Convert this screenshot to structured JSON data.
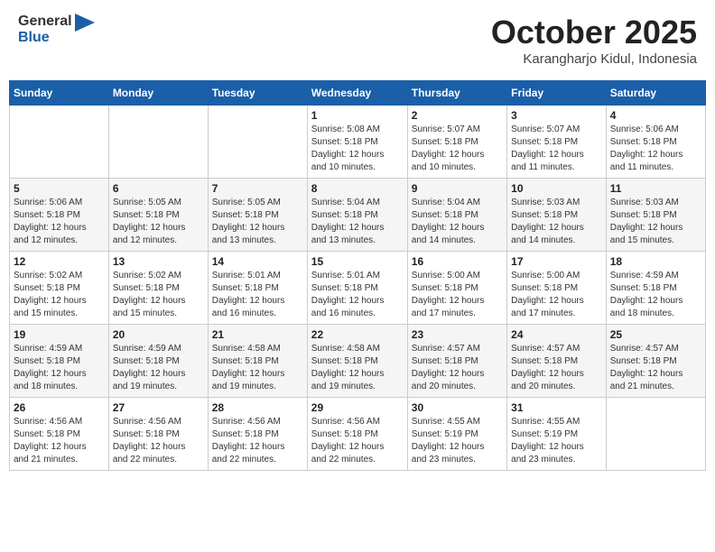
{
  "header": {
    "logo_line1": "General",
    "logo_line2": "Blue",
    "month": "October 2025",
    "location": "Karangharjo Kidul, Indonesia"
  },
  "calendar": {
    "days_of_week": [
      "Sunday",
      "Monday",
      "Tuesday",
      "Wednesday",
      "Thursday",
      "Friday",
      "Saturday"
    ],
    "weeks": [
      [
        {
          "day": "",
          "info": ""
        },
        {
          "day": "",
          "info": ""
        },
        {
          "day": "",
          "info": ""
        },
        {
          "day": "1",
          "info": "Sunrise: 5:08 AM\nSunset: 5:18 PM\nDaylight: 12 hours\nand 10 minutes."
        },
        {
          "day": "2",
          "info": "Sunrise: 5:07 AM\nSunset: 5:18 PM\nDaylight: 12 hours\nand 10 minutes."
        },
        {
          "day": "3",
          "info": "Sunrise: 5:07 AM\nSunset: 5:18 PM\nDaylight: 12 hours\nand 11 minutes."
        },
        {
          "day": "4",
          "info": "Sunrise: 5:06 AM\nSunset: 5:18 PM\nDaylight: 12 hours\nand 11 minutes."
        }
      ],
      [
        {
          "day": "5",
          "info": "Sunrise: 5:06 AM\nSunset: 5:18 PM\nDaylight: 12 hours\nand 12 minutes."
        },
        {
          "day": "6",
          "info": "Sunrise: 5:05 AM\nSunset: 5:18 PM\nDaylight: 12 hours\nand 12 minutes."
        },
        {
          "day": "7",
          "info": "Sunrise: 5:05 AM\nSunset: 5:18 PM\nDaylight: 12 hours\nand 13 minutes."
        },
        {
          "day": "8",
          "info": "Sunrise: 5:04 AM\nSunset: 5:18 PM\nDaylight: 12 hours\nand 13 minutes."
        },
        {
          "day": "9",
          "info": "Sunrise: 5:04 AM\nSunset: 5:18 PM\nDaylight: 12 hours\nand 14 minutes."
        },
        {
          "day": "10",
          "info": "Sunrise: 5:03 AM\nSunset: 5:18 PM\nDaylight: 12 hours\nand 14 minutes."
        },
        {
          "day": "11",
          "info": "Sunrise: 5:03 AM\nSunset: 5:18 PM\nDaylight: 12 hours\nand 15 minutes."
        }
      ],
      [
        {
          "day": "12",
          "info": "Sunrise: 5:02 AM\nSunset: 5:18 PM\nDaylight: 12 hours\nand 15 minutes."
        },
        {
          "day": "13",
          "info": "Sunrise: 5:02 AM\nSunset: 5:18 PM\nDaylight: 12 hours\nand 15 minutes."
        },
        {
          "day": "14",
          "info": "Sunrise: 5:01 AM\nSunset: 5:18 PM\nDaylight: 12 hours\nand 16 minutes."
        },
        {
          "day": "15",
          "info": "Sunrise: 5:01 AM\nSunset: 5:18 PM\nDaylight: 12 hours\nand 16 minutes."
        },
        {
          "day": "16",
          "info": "Sunrise: 5:00 AM\nSunset: 5:18 PM\nDaylight: 12 hours\nand 17 minutes."
        },
        {
          "day": "17",
          "info": "Sunrise: 5:00 AM\nSunset: 5:18 PM\nDaylight: 12 hours\nand 17 minutes."
        },
        {
          "day": "18",
          "info": "Sunrise: 4:59 AM\nSunset: 5:18 PM\nDaylight: 12 hours\nand 18 minutes."
        }
      ],
      [
        {
          "day": "19",
          "info": "Sunrise: 4:59 AM\nSunset: 5:18 PM\nDaylight: 12 hours\nand 18 minutes."
        },
        {
          "day": "20",
          "info": "Sunrise: 4:59 AM\nSunset: 5:18 PM\nDaylight: 12 hours\nand 19 minutes."
        },
        {
          "day": "21",
          "info": "Sunrise: 4:58 AM\nSunset: 5:18 PM\nDaylight: 12 hours\nand 19 minutes."
        },
        {
          "day": "22",
          "info": "Sunrise: 4:58 AM\nSunset: 5:18 PM\nDaylight: 12 hours\nand 19 minutes."
        },
        {
          "day": "23",
          "info": "Sunrise: 4:57 AM\nSunset: 5:18 PM\nDaylight: 12 hours\nand 20 minutes."
        },
        {
          "day": "24",
          "info": "Sunrise: 4:57 AM\nSunset: 5:18 PM\nDaylight: 12 hours\nand 20 minutes."
        },
        {
          "day": "25",
          "info": "Sunrise: 4:57 AM\nSunset: 5:18 PM\nDaylight: 12 hours\nand 21 minutes."
        }
      ],
      [
        {
          "day": "26",
          "info": "Sunrise: 4:56 AM\nSunset: 5:18 PM\nDaylight: 12 hours\nand 21 minutes."
        },
        {
          "day": "27",
          "info": "Sunrise: 4:56 AM\nSunset: 5:18 PM\nDaylight: 12 hours\nand 22 minutes."
        },
        {
          "day": "28",
          "info": "Sunrise: 4:56 AM\nSunset: 5:18 PM\nDaylight: 12 hours\nand 22 minutes."
        },
        {
          "day": "29",
          "info": "Sunrise: 4:56 AM\nSunset: 5:18 PM\nDaylight: 12 hours\nand 22 minutes."
        },
        {
          "day": "30",
          "info": "Sunrise: 4:55 AM\nSunset: 5:19 PM\nDaylight: 12 hours\nand 23 minutes."
        },
        {
          "day": "31",
          "info": "Sunrise: 4:55 AM\nSunset: 5:19 PM\nDaylight: 12 hours\nand 23 minutes."
        },
        {
          "day": "",
          "info": ""
        }
      ]
    ]
  }
}
